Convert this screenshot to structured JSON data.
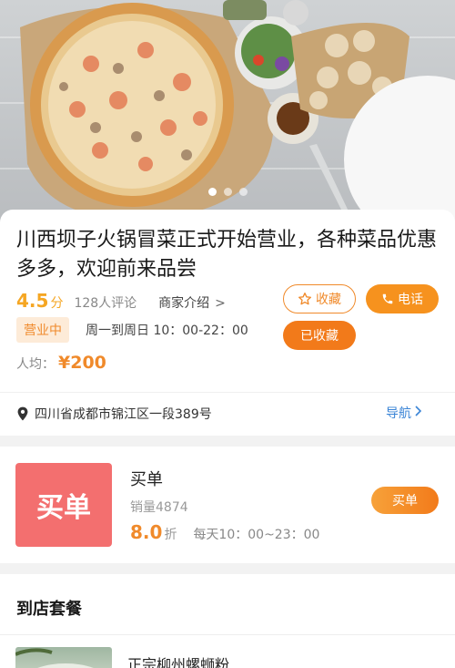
{
  "hero": {
    "carousel_pages": 3,
    "active_page": 0
  },
  "shop": {
    "title": "川西坝子火锅冒菜正式开始营业，各种菜品优惠多多，欢迎前来品尝",
    "score": "4.5",
    "score_unit": "分",
    "reviews": "128人评论",
    "merchant_intro": "商家介绍",
    "status": "营业中",
    "hours": "周一到周日 10：00-22：00",
    "avg_label": "人均：",
    "avg_price": "¥200",
    "address": "四川省成都市锦江区一段389号",
    "nav_label": "导航"
  },
  "actions": {
    "favorite": "收藏",
    "call": "电话",
    "favorited": "已收藏"
  },
  "purchase": {
    "thumb_text": "买单",
    "name": "买单",
    "sales": "销量4874",
    "discount": "8.0",
    "discount_unit": "折",
    "hours": "每天10：00~23：00",
    "button": "买单"
  },
  "packages": {
    "section_title": "到店套餐",
    "first_item_name": "正宗柳州螺蛳粉"
  },
  "colors": {
    "accent": "#f08a2b",
    "link": "#3a84d6",
    "thumb": "#f36f6f"
  }
}
